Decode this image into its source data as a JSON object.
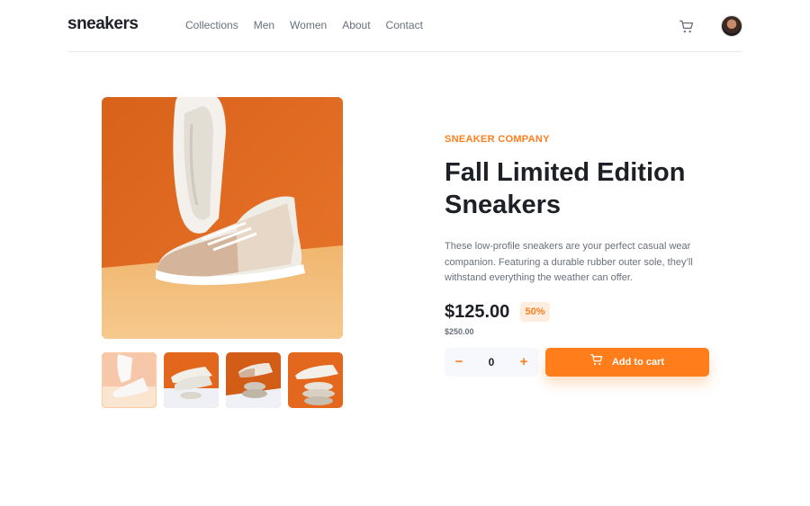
{
  "header": {
    "logo": "sneakers",
    "nav": [
      "Collections",
      "Men",
      "Women",
      "About",
      "Contact"
    ],
    "cart_icon": "cart-icon",
    "avatar_icon": "user-avatar"
  },
  "product": {
    "company": "SNEAKER COMPANY",
    "title": "Fall Limited Edition Sneakers",
    "description": "These low-profile sneakers are your perfect casual wear companion. Featuring a durable rubber outer sole, they’ll withstand everything the weather can offer.",
    "price": "$125.00",
    "discount": "50%",
    "original_price": "$250.00"
  },
  "quantity": {
    "minus": "−",
    "value": "0",
    "plus": "+"
  },
  "cart_button": {
    "label": "Add to cart",
    "icon": "cart-icon"
  },
  "gallery": {
    "active_thumbnail": 1,
    "thumbnail_count": 4
  },
  "colors": {
    "accent": "#ff7e1b",
    "accent_pale": "#ffede0",
    "text_dark": "#1d2026",
    "text_muted": "#69707d"
  }
}
